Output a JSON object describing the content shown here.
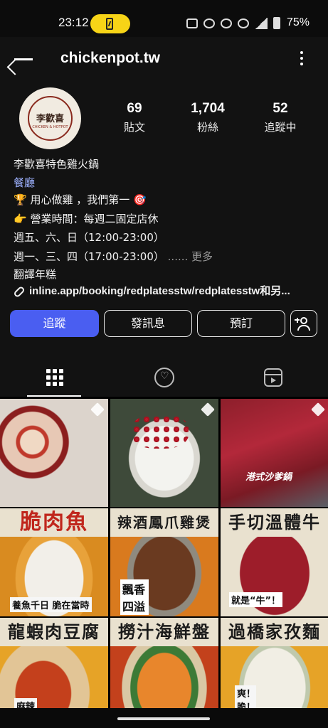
{
  "status_bar": {
    "time": "23:12",
    "battery": "75%"
  },
  "header": {
    "username": "chickenpot.tw"
  },
  "profile": {
    "logo_text": "李歡喜",
    "logo_subtext": "CHICKEN & HOTPOT",
    "stats": [
      {
        "value": "69",
        "label": "貼文"
      },
      {
        "value": "1,704",
        "label": "粉絲"
      },
      {
        "value": "52",
        "label": "追蹤中"
      }
    ],
    "name": "李歡喜特色雞火鍋",
    "category": "餐廳",
    "bio_lines": [
      "🏆 用心做雞 ，我們第一 🎯",
      "👉 營業時間：每週二固定店休",
      "週五、六、日（12:00-23:00）",
      "週一、三、四（17:00-23:00）"
    ],
    "more_text": "...... 更多",
    "translate": "翻譯年糕",
    "link": "inline.app/booking/redplatesstw/redplatesstw和另..."
  },
  "actions": {
    "follow": "追蹤",
    "message": "發訊息",
    "book": "預訂"
  },
  "grid": {
    "tiles": [
      {
        "banner": "",
        "caption": ""
      },
      {
        "banner": "",
        "caption": ""
      },
      {
        "banner": "",
        "caption": "港式沙爹鍋"
      },
      {
        "banner": "脆肉魚",
        "caption": "養魚千日 脆在當時"
      },
      {
        "banner": "辣酒鳳爪雞煲",
        "caption": "飄香 四溢"
      },
      {
        "banner": "手切溫體牛",
        "caption": "就是“牛”！"
      },
      {
        "banner": "龍蝦肉豆腐",
        "caption": "麻辣"
      },
      {
        "banner": "撈汁海鮮盤",
        "caption": ""
      },
      {
        "banner": "過橋家孜麵",
        "caption": "爽！脆！"
      }
    ]
  },
  "colors": {
    "background": "#121212",
    "accent": "#4a5ef1",
    "category": "#9db1ff"
  }
}
